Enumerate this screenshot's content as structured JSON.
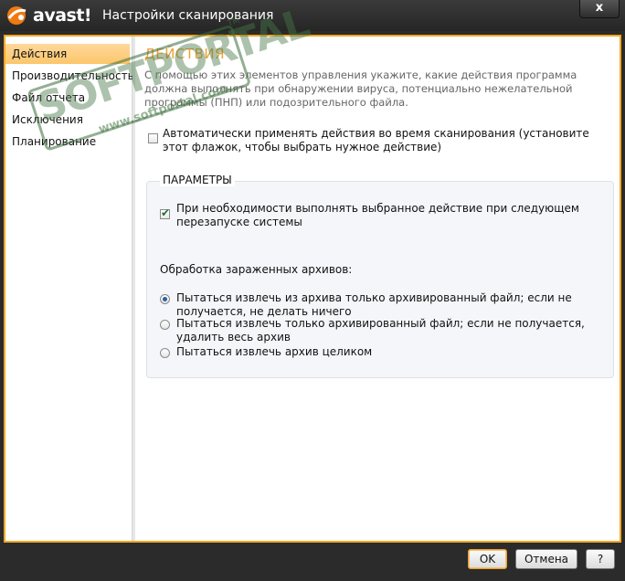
{
  "window": {
    "app_logo_text": "avast!",
    "title": "Настройки сканирования",
    "close_label": "x"
  },
  "sidebar": {
    "items": [
      {
        "label": "Действия",
        "active": true
      },
      {
        "label": "Производительность",
        "active": false
      },
      {
        "label": "Файл отчета",
        "active": false
      },
      {
        "label": "Исключения",
        "active": false
      },
      {
        "label": "Планирование",
        "active": false
      }
    ]
  },
  "main": {
    "heading": "ДЕЙСТВИЯ",
    "description": "С помощью этих элементов управления укажите, какие действия программа должна выполнять при обнаружении вируса, потенциально нежелательной программы (ПНП) или подозрительного файла.",
    "auto_apply": {
      "checked": false,
      "label": "Автоматически применять действия во время сканирования (установите этот флажок, чтобы выбрать нужное действие)"
    },
    "params_group": {
      "title": "ПАРАМЕТРЫ",
      "restart_action": {
        "checked": true,
        "label": "При необходимости выполнять выбранное действие при следующем перезапуске системы"
      },
      "archives_label": "Обработка зараженных архивов:",
      "archive_options": [
        {
          "label": "Пытаться извлечь из архива только архивированный файл; если не получается, не делать ничего",
          "selected": true
        },
        {
          "label": "Пытаться извлечь только архивированный файл; если не получается, удалить весь архив",
          "selected": false
        },
        {
          "label": "Пытаться извлечь архив целиком",
          "selected": false
        }
      ]
    }
  },
  "footer": {
    "ok_label": "OK",
    "cancel_label": "Отмена",
    "help_label": "?"
  },
  "watermark": {
    "text": "SOFTPORTAL",
    "url": "www.softportal.com",
    "tm": "TM"
  },
  "colors": {
    "accent": "#f5a623",
    "heading": "#f0a030",
    "titlebar": "#2b2b2b",
    "active_item": "#fcc66b"
  },
  "icons": {
    "logo": "avast-ball-icon",
    "close": "close-icon"
  }
}
